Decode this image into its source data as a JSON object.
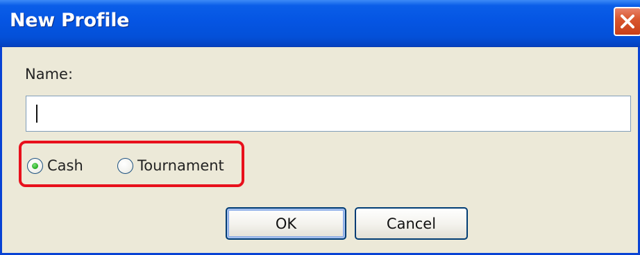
{
  "window": {
    "title": "New Profile"
  },
  "form": {
    "name_label": "Name:",
    "name_value": "",
    "game_type": {
      "options": [
        {
          "label": "Cash",
          "selected": true
        },
        {
          "label": "Tournament",
          "selected": false
        }
      ]
    }
  },
  "buttons": {
    "ok_label": "OK",
    "cancel_label": "Cancel"
  },
  "colors": {
    "titlebar": "#0555e3",
    "dialog_background": "#ece9d8",
    "highlight_outline": "#e8101c",
    "close_button": "#d9572f"
  },
  "icons": {
    "close": "close-x-icon"
  }
}
